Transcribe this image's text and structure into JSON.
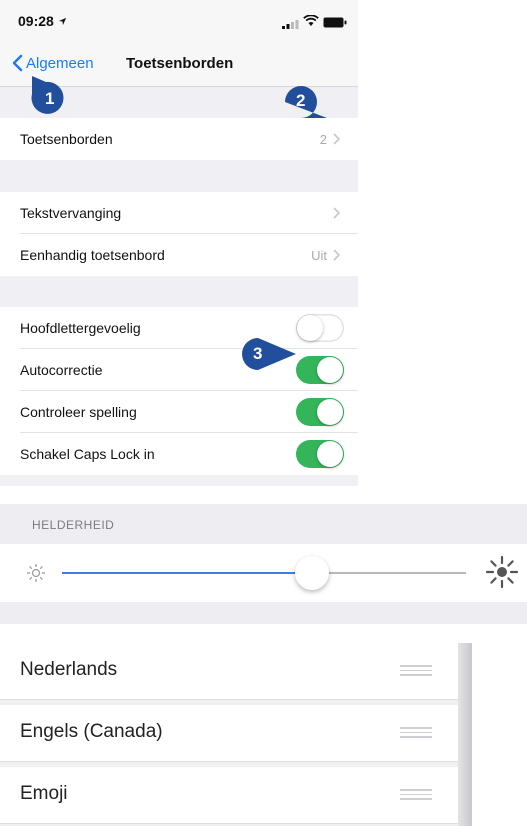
{
  "status_bar": {
    "time": "09:28"
  },
  "nav": {
    "back_label": "Algemeen",
    "title": "Toetsenborden"
  },
  "keyboards": {
    "label": "Toetsenborden",
    "value": "2"
  },
  "settings_group_1": [
    {
      "label": "Tekstvervanging",
      "value": ""
    },
    {
      "label": "Eenhandig toetsenbord",
      "value": "Uit"
    }
  ],
  "toggles": [
    {
      "label": "Hoofdlettergevoelig",
      "on": false
    },
    {
      "label": "Autocorrectie",
      "on": true
    },
    {
      "label": "Controleer spelling",
      "on": true
    },
    {
      "label": "Schakel Caps Lock in",
      "on": true
    }
  ],
  "badges": {
    "one": "1",
    "two": "2",
    "three": "3"
  },
  "brightness": {
    "header": "HELDERHEID",
    "level": 0.62
  },
  "languages": [
    {
      "name": "Nederlands"
    },
    {
      "name": "Engels (Canada)"
    },
    {
      "name": "Emoji"
    }
  ],
  "colors": {
    "accent": "#1a7cf5",
    "toggle_on": "#34b55a",
    "badge": "#214f9c",
    "slider_fill": "#3d7ee6"
  }
}
